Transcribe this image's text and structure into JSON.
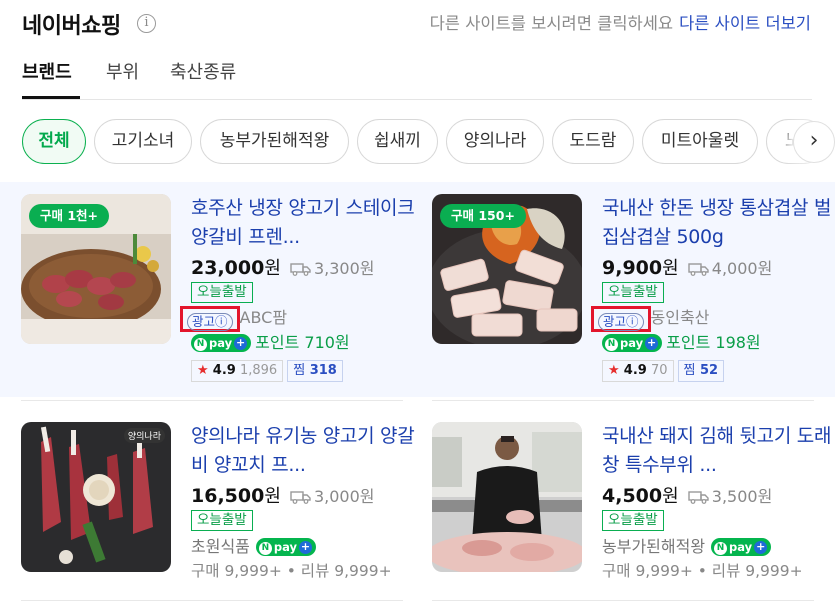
{
  "header": {
    "title": "네이버쇼핑",
    "info_icon": "i",
    "other_site_hint": "다른 사이트를 보시려면 클릭하세요",
    "other_site_link": "다른 사이트 더보기"
  },
  "tabs": [
    {
      "label": "브랜드",
      "active": true
    },
    {
      "label": "부위",
      "active": false
    },
    {
      "label": "축산종류",
      "active": false
    }
  ],
  "chips": [
    "전체",
    "고기소녀",
    "농부가된해적왕",
    "쉽새끼",
    "양의나라",
    "도드람",
    "미트아울렛",
    "노"
  ],
  "chip_next_icon": "›",
  "products": [
    {
      "badge": "구매 1천+",
      "name": "호주산 냉장 양고기 스테이크 양갈비 프렌...",
      "price": "23,000",
      "won": "원",
      "shipping": "3,300원",
      "today_label": "오늘출발",
      "ad_label": "광고ⓘ",
      "seller": "ABC팜",
      "npay_text": "pay",
      "point": "포인트 710원",
      "rating": "4.9",
      "review_count": "1,896",
      "zzim_label": "찜",
      "zzim_count": "318"
    },
    {
      "badge": "구매 150+",
      "name": "국내산 한돈 냉장 통삼겹살 벌집삼겹살 500g",
      "price": "9,900",
      "won": "원",
      "shipping": "4,000원",
      "today_label": "오늘출발",
      "ad_label": "광고ⓘ",
      "seller": "동인축산",
      "npay_text": "pay",
      "point": "포인트 198원",
      "rating": "4.9",
      "review_count": "70",
      "zzim_label": "찜",
      "zzim_count": "52"
    },
    {
      "name": "양의나라 유기농 양고기 양갈비 양꼬치 프...",
      "price": "16,500",
      "won": "원",
      "shipping": "3,000원",
      "today_label": "오늘출발",
      "seller": "초원식품",
      "npay_text": "pay",
      "stats": "구매 9,999+ • 리뷰 9,999+",
      "thumb_logo": "양의나라"
    },
    {
      "name": "국내산 돼지 김해 뒷고기 도래창 특수부위 ...",
      "price": "4,500",
      "won": "원",
      "shipping": "3,500원",
      "today_label": "오늘출발",
      "seller": "농부가된해적왕",
      "npay_text": "pay",
      "stats": "구매 9,999+ • 리뷰 9,999+"
    }
  ],
  "colors": {
    "accent_green": "#03a94d",
    "link_blue": "#1b3fad",
    "ad_highlight": "#e3152c",
    "ad_band": "#f4f7ff"
  }
}
